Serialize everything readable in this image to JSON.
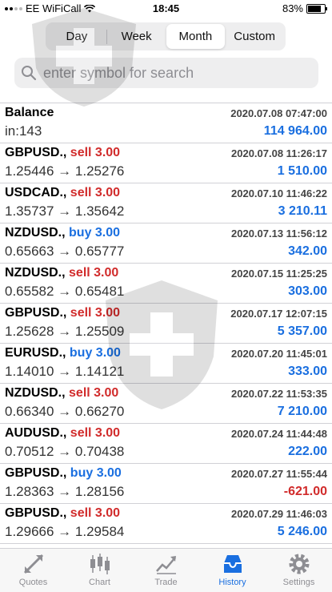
{
  "status_bar": {
    "carrier": "EE WiFiCall",
    "time": "18:45",
    "battery_percent": "83%",
    "battery_level": 0.83
  },
  "period_tabs": {
    "items": [
      "Day",
      "Week",
      "Month",
      "Custom"
    ],
    "selected": "Month"
  },
  "search": {
    "placeholder": "enter symbol for search",
    "value": ""
  },
  "balance": {
    "title": "Balance",
    "subtitle": "in:143",
    "datetime": "2020.07.08 07:47:00",
    "amount": "114 964.00"
  },
  "deals": [
    {
      "symbol": "GBPUSD.,",
      "type": "sell 3.00",
      "side": "sell",
      "prices": "1.25446 → 1.25276",
      "datetime": "2020.07.08 11:26:17",
      "profit": "1 510.00",
      "negative": false
    },
    {
      "symbol": "USDCAD.,",
      "type": "sell 3.00",
      "side": "sell",
      "prices": "1.35737 → 1.35642",
      "datetime": "2020.07.10 11:46:22",
      "profit": "3 210.11",
      "negative": false
    },
    {
      "symbol": "NZDUSD.,",
      "type": "buy 3.00",
      "side": "buy",
      "prices": "0.65663 → 0.65777",
      "datetime": "2020.07.13 11:56:12",
      "profit": "342.00",
      "negative": false
    },
    {
      "symbol": "NZDUSD.,",
      "type": "sell 3.00",
      "side": "sell",
      "prices": "0.65582 → 0.65481",
      "datetime": "2020.07.15 11:25:25",
      "profit": "303.00",
      "negative": false
    },
    {
      "symbol": "GBPUSD.,",
      "type": "sell 3.00",
      "side": "sell",
      "prices": "1.25628 → 1.25509",
      "datetime": "2020.07.17 12:07:15",
      "profit": "5 357.00",
      "negative": false
    },
    {
      "symbol": "EURUSD.,",
      "type": "buy 3.00",
      "side": "buy",
      "prices": "1.14010 → 1.14121",
      "datetime": "2020.07.20 11:45:01",
      "profit": "333.00",
      "negative": false
    },
    {
      "symbol": "NZDUSD.,",
      "type": "sell 3.00",
      "side": "sell",
      "prices": "0.66340 → 0.66270",
      "datetime": "2020.07.22 11:53:35",
      "profit": "7 210.00",
      "negative": false
    },
    {
      "symbol": "AUDUSD.,",
      "type": "sell 3.00",
      "side": "sell",
      "prices": "0.70512 → 0.70438",
      "datetime": "2020.07.24 11:44:48",
      "profit": "222.00",
      "negative": false
    },
    {
      "symbol": "GBPUSD.,",
      "type": "buy 3.00",
      "side": "buy",
      "prices": "1.28363 → 1.28156",
      "datetime": "2020.07.27 11:55:44",
      "profit": "-621.00",
      "negative": true
    },
    {
      "symbol": "GBPUSD.,",
      "type": "sell 3.00",
      "side": "sell",
      "prices": "1.29666 → 1.29584",
      "datetime": "2020.07.29 11:46:03",
      "profit": "5 246.00",
      "negative": false
    }
  ],
  "tabbar": {
    "items": [
      {
        "label": "Quotes",
        "icon": "quotes-icon"
      },
      {
        "label": "Chart",
        "icon": "chart-icon"
      },
      {
        "label": "Trade",
        "icon": "trade-icon"
      },
      {
        "label": "History",
        "icon": "history-icon"
      },
      {
        "label": "Settings",
        "icon": "settings-icon"
      }
    ],
    "selected": "History"
  },
  "colors": {
    "accent_blue": "#1a6fe0",
    "sell_red": "#d12b2b",
    "separator": "#d1d1d6"
  }
}
